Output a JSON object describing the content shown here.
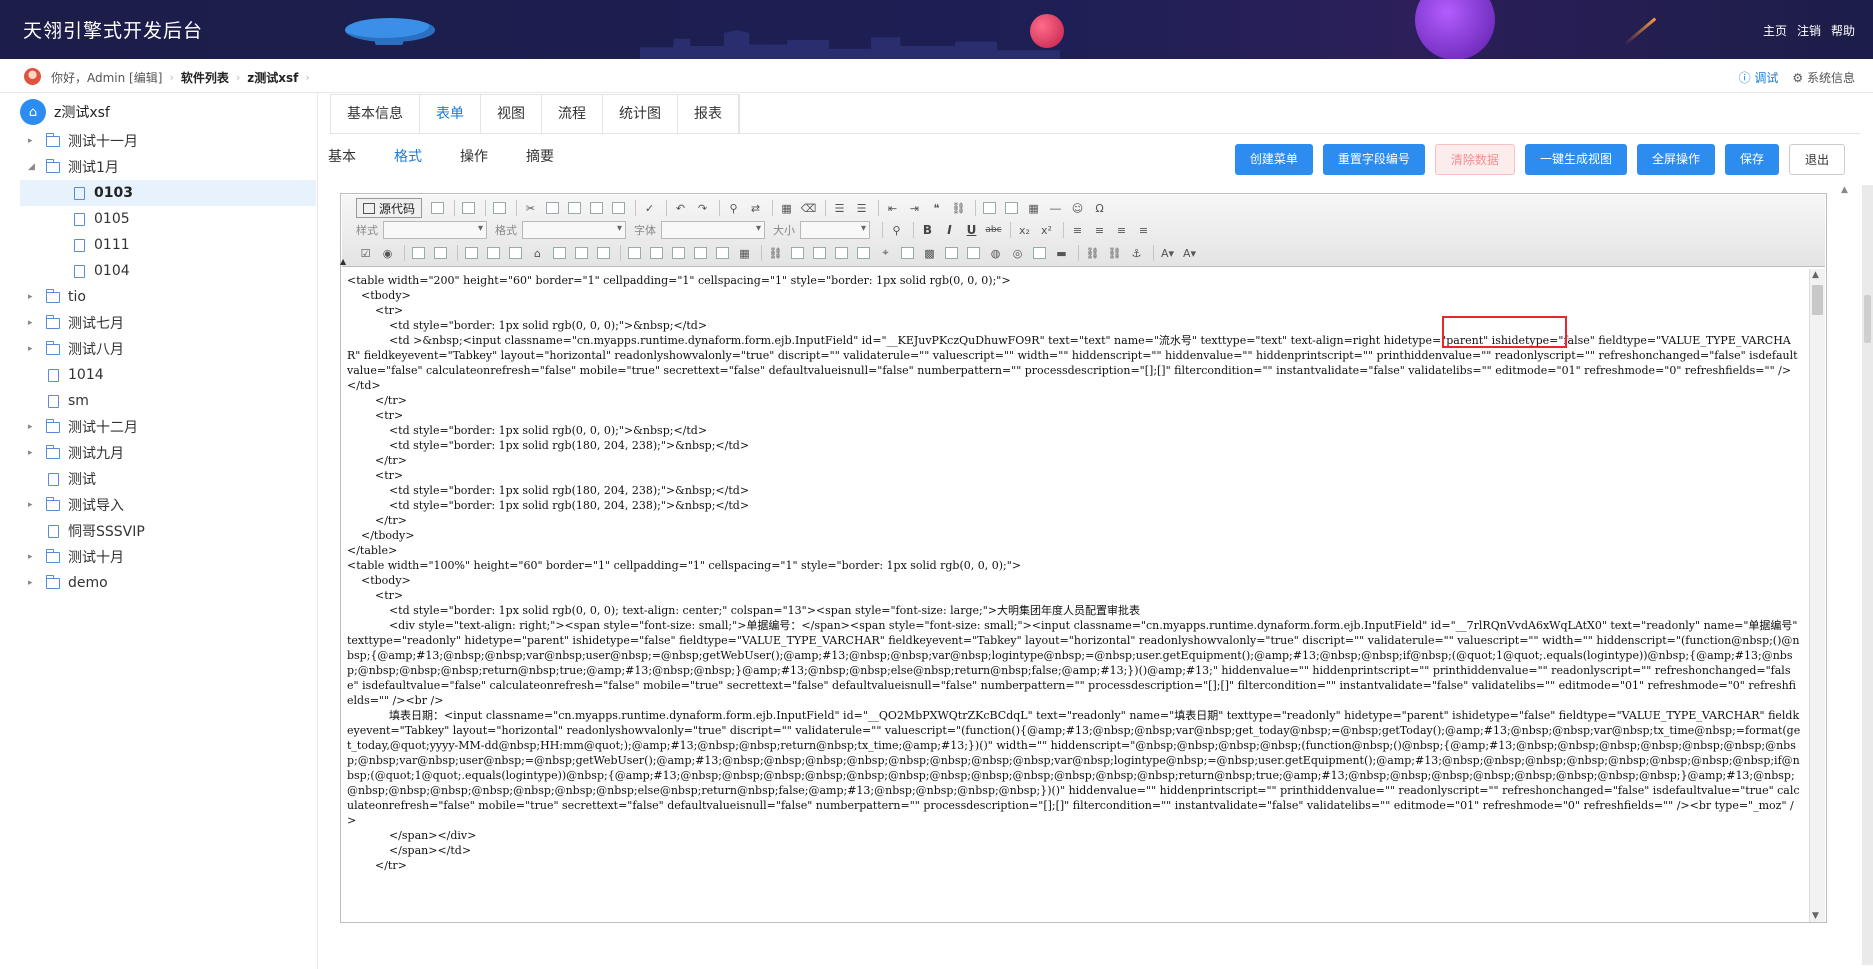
{
  "app": {
    "title": "天翎引擎式开发后台"
  },
  "top_links": [
    "主页",
    "注销",
    "帮助"
  ],
  "breadcrumb": {
    "greeting": "你好，Admin [编辑]",
    "items": [
      "软件列表",
      "z测试xsf"
    ]
  },
  "right_info": {
    "debug": "ⓘ 调试",
    "system": "⚙ 系统信息"
  },
  "tree": {
    "root": "z测试xsf",
    "nodes": [
      {
        "label": "测试十一月",
        "type": "folder",
        "expanded": false,
        "level": 1
      },
      {
        "label": "测试1月",
        "type": "folder",
        "expanded": true,
        "level": 1
      },
      {
        "label": "0103",
        "type": "doc",
        "level": 2,
        "active": true
      },
      {
        "label": "0105",
        "type": "doc",
        "level": 2
      },
      {
        "label": "0111",
        "type": "doc",
        "level": 2
      },
      {
        "label": "0104",
        "type": "doc",
        "level": 2
      },
      {
        "label": "tio",
        "type": "folder",
        "expanded": false,
        "level": 1
      },
      {
        "label": "测试七月",
        "type": "folder",
        "expanded": false,
        "level": 1
      },
      {
        "label": "测试八月",
        "type": "folder",
        "expanded": false,
        "level": 1
      },
      {
        "label": "1014",
        "type": "doc",
        "level": 1
      },
      {
        "label": "sm",
        "type": "doc",
        "level": 1
      },
      {
        "label": "测试十二月",
        "type": "folder",
        "expanded": false,
        "level": 1
      },
      {
        "label": "测试九月",
        "type": "folder",
        "expanded": false,
        "level": 1
      },
      {
        "label": "测试",
        "type": "doc",
        "level": 1
      },
      {
        "label": "测试导入",
        "type": "folder",
        "expanded": false,
        "level": 1
      },
      {
        "label": "恫哥SSSVIP",
        "type": "doc",
        "level": 1
      },
      {
        "label": "测试十月",
        "type": "folder",
        "expanded": false,
        "level": 1
      },
      {
        "label": "demo",
        "type": "folder",
        "expanded": false,
        "level": 1
      }
    ]
  },
  "main_tabs": [
    {
      "label": "基本信息",
      "active": false
    },
    {
      "label": "表单",
      "active": true
    },
    {
      "label": "视图",
      "active": false
    },
    {
      "label": "流程",
      "active": false
    },
    {
      "label": "统计图",
      "active": false
    },
    {
      "label": "报表",
      "active": false
    }
  ],
  "sub_tabs": [
    {
      "label": "基本",
      "active": false
    },
    {
      "label": "格式",
      "active": true
    },
    {
      "label": "操作",
      "active": false
    },
    {
      "label": "摘要",
      "active": false
    }
  ],
  "actions": [
    {
      "label": "创建菜单",
      "style": "primary"
    },
    {
      "label": "重置字段编号",
      "style": "primary"
    },
    {
      "label": "清除数据",
      "style": "danger"
    },
    {
      "label": "一键生成视图",
      "style": "primary"
    },
    {
      "label": "全屏操作",
      "style": "primary"
    },
    {
      "label": "保存",
      "style": "primary"
    },
    {
      "label": "退出",
      "style": "plain"
    }
  ],
  "editor": {
    "source_button": "源代码",
    "combos": [
      {
        "label": "样式",
        "short": false
      },
      {
        "label": "格式",
        "short": false
      },
      {
        "label": "字体",
        "short": false
      },
      {
        "label": "大小",
        "short": true
      }
    ],
    "format_buttons": [
      "B",
      "I",
      "U",
      "abc",
      "x₂",
      "x²"
    ],
    "code_lines": [
      "<table width=\"200\" height=\"60\" border=\"1\" cellpadding=\"1\" cellspacing=\"1\" style=\"border: 1px solid rgb(0, 0, 0);\">",
      "    <tbody>",
      "        <tr>",
      "            <td style=\"border: 1px solid rgb(0, 0, 0);\">&nbsp;</td>",
      "            <td >&nbsp;<input classname=\"cn.myapps.runtime.dynaform.form.ejb.InputField\" id=\"__KEJuvPKczQuDhuwFO9R\" text=\"text\" name=\"流水号\" texttype=\"text\" text-align=right hidetype=\"parent\" ishidetype=\"false\" fieldtype=\"VALUE_TYPE_VARCHAR\" fieldkeyevent=\"Tabkey\" layout=\"horizontal\" readonlyshowvalonly=\"true\" discript=\"\" validaterule=\"\" valuescript=\"\" width=\"\" hiddenscript=\"\" hiddenvalue=\"\" hiddenprintscript=\"\" printhiddenvalue=\"\" readonlyscript=\"\" refreshonchanged=\"false\" isdefaultvalue=\"false\" calculateonrefresh=\"false\" mobile=\"true\" secrettext=\"false\" defaultvalueisnull=\"false\" numberpattern=\"\" processdescription=\"[];[]\" filtercondition=\"\" instantvalidate=\"false\" validatelibs=\"\" editmode=\"01\" refreshmode=\"0\" refreshfields=\"\" /></td>",
      "        </tr>",
      "        <tr>",
      "            <td style=\"border: 1px solid rgb(0, 0, 0);\">&nbsp;</td>",
      "            <td style=\"border: 1px solid rgb(180, 204, 238);\">&nbsp;</td>",
      "        </tr>",
      "        <tr>",
      "            <td style=\"border: 1px solid rgb(180, 204, 238);\">&nbsp;</td>",
      "            <td style=\"border: 1px solid rgb(180, 204, 238);\">&nbsp;</td>",
      "        </tr>",
      "    </tbody>",
      "</table>",
      "<table width=\"100%\" height=\"60\" border=\"1\" cellpadding=\"1\" cellspacing=\"1\" style=\"border: 1px solid rgb(0, 0, 0);\">",
      "    <tbody>",
      "        <tr>",
      "            <td style=\"border: 1px solid rgb(0, 0, 0); text-align: center;\" colspan=\"13\"><span style=\"font-size: large;\">大明集团年度人员配置审批表",
      "            <div style=\"text-align: right;\"><span style=\"font-size: small;\">单据编号：</span><span style=\"font-size: small;\"><input classname=\"cn.myapps.runtime.dynaform.form.ejb.InputField\" id=\"__7rlRQnVvdA6xWqLAtX0\" text=\"readonly\" name=\"单据编号\" texttype=\"readonly\" hidetype=\"parent\" ishidetype=\"false\" fieldtype=\"VALUE_TYPE_VARCHAR\" fieldkeyevent=\"Tabkey\" layout=\"horizontal\" readonlyshowvalonly=\"true\" discript=\"\" validaterule=\"\" valuescript=\"\" width=\"\" hiddenscript=\"(function@nbsp;()@nbsp;{@amp;#13;@nbsp;@nbsp;var@nbsp;user@nbsp;=@nbsp;getWebUser();@amp;#13;@nbsp;@nbsp;var@nbsp;logintype@nbsp;=@nbsp;user.getEquipment();@amp;#13;@nbsp;@nbsp;if@nbsp;(@quot;1@quot;.equals(logintype))@nbsp;{@amp;#13;@nbsp;@nbsp;@nbsp;@nbsp;return@nbsp;true;@amp;#13;@nbsp;@nbsp;}@amp;#13;@nbsp;@nbsp;else@nbsp;return@nbsp;false;@amp;#13;})()@amp;#13;\" hiddenvalue=\"\" hiddenprintscript=\"\" printhiddenvalue=\"\" readonlyscript=\"\" refreshonchanged=\"false\" isdefaultvalue=\"false\" calculateonrefresh=\"false\" mobile=\"true\" secrettext=\"false\" defaultvalueisnull=\"false\" numberpattern=\"\" processdescription=\"[];[]\" filtercondition=\"\" instantvalidate=\"false\" validatelibs=\"\" editmode=\"01\" refreshmode=\"0\" refreshfields=\"\" /><br />",
      "            填表日期：<input classname=\"cn.myapps.runtime.dynaform.form.ejb.InputField\" id=\"__QO2MbPXWQtrZKcBCdqL\" text=\"readonly\" name=\"填表日期\" texttype=\"readonly\" hidetype=\"parent\" ishidetype=\"false\" fieldtype=\"VALUE_TYPE_VARCHAR\" fieldkeyevent=\"Tabkey\" layout=\"horizontal\" readonlyshowvalonly=\"true\" discript=\"\" validaterule=\"\" valuescript=\"(function(){@amp;#13;@nbsp;@nbsp;var@nbsp;get_today@nbsp;=@nbsp;getToday();@amp;#13;@nbsp;@nbsp;var@nbsp;tx_time@nbsp;=format(get_today,@quot;yyyy-MM-dd@nbsp;HH:mm@quot;);@amp;#13;@nbsp;@nbsp;return@nbsp;tx_time;@amp;#13;})()\" width=\"\" hiddenscript=\"@nbsp;@nbsp;@nbsp;@nbsp;(function@nbsp;()@nbsp;{@amp;#13;@nbsp;@nbsp;@nbsp;@nbsp;@nbsp;@nbsp;@nbsp;@nbsp;var@nbsp;user@nbsp;=@nbsp;getWebUser();@amp;#13;@nbsp;@nbsp;@nbsp;@nbsp;@nbsp;@nbsp;@nbsp;@nbsp;var@nbsp;logintype@nbsp;=@nbsp;user.getEquipment();@amp;#13;@nbsp;@nbsp;@nbsp;@nbsp;@nbsp;@nbsp;@nbsp;@nbsp;if@nbsp;(@quot;1@quot;.equals(logintype))@nbsp;{@amp;#13;@nbsp;@nbsp;@nbsp;@nbsp;@nbsp;@nbsp;@nbsp;@nbsp;@nbsp;@nbsp;@nbsp;@nbsp;return@nbsp;true;@amp;#13;@nbsp;@nbsp;@nbsp;@nbsp;@nbsp;@nbsp;@nbsp;@nbsp;}@amp;#13;@nbsp;@nbsp;@nbsp;@nbsp;@nbsp;@nbsp;@nbsp;@nbsp;else@nbsp;return@nbsp;false;@amp;#13;@nbsp;@nbsp;@nbsp;@nbsp;})()\" hiddenvalue=\"\" hiddenprintscript=\"\" printhiddenvalue=\"\" readonlyscript=\"\" refreshonchanged=\"false\" isdefaultvalue=\"true\" calculateonrefresh=\"false\" mobile=\"true\" secrettext=\"false\" defaultvalueisnull=\"false\" numberpattern=\"\" processdescription=\"[];[]\" filtercondition=\"\" instantvalidate=\"false\" validatelibs=\"\" editmode=\"01\" refreshmode=\"0\" refreshfields=\"\" /><br type=\"_moz\" />",
      "            </span></div>",
      "            </span></td>",
      "        </tr>"
    ]
  }
}
